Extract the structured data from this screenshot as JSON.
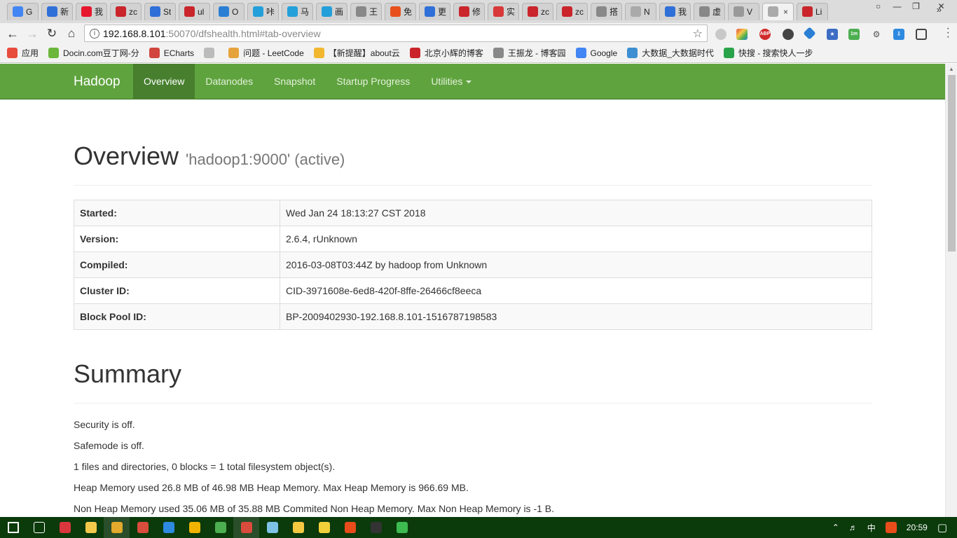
{
  "tabs": [
    {
      "title": "G",
      "icon": "google-icon",
      "color": "#4285f4"
    },
    {
      "title": "新",
      "icon": "baidu-icon",
      "color": "#2f6fd8"
    },
    {
      "title": "我",
      "icon": "weibo-icon",
      "color": "#e6162d"
    },
    {
      "title": "zc",
      "icon": "csdn-icon",
      "color": "#c9252b"
    },
    {
      "title": "St",
      "icon": "baidu-icon",
      "color": "#2f6fd8"
    },
    {
      "title": "ul",
      "icon": "csdn-icon",
      "color": "#c9252b"
    },
    {
      "title": "O",
      "icon": "diamond-icon",
      "color": "#2a7fd4"
    },
    {
      "title": "咔",
      "icon": "tv-icon",
      "color": "#23a0da"
    },
    {
      "title": "马",
      "icon": "tv-icon",
      "color": "#23a0da"
    },
    {
      "title": "画",
      "icon": "tv-icon",
      "color": "#23a0da"
    },
    {
      "title": "王",
      "icon": "cnblogs-icon",
      "color": "#888888"
    },
    {
      "title": "免",
      "icon": "q-icon",
      "color": "#e8511c"
    },
    {
      "title": "更",
      "icon": "baidu-icon",
      "color": "#2f6fd8"
    },
    {
      "title": "修",
      "icon": "csdn-icon",
      "color": "#c9252b"
    },
    {
      "title": "实",
      "icon": "red-icon",
      "color": "#d8383a"
    },
    {
      "title": "zc",
      "icon": "csdn-icon",
      "color": "#c9252b"
    },
    {
      "title": "zc",
      "icon": "csdn-icon",
      "color": "#c9252b"
    },
    {
      "title": "搭",
      "icon": "cnblogs-icon",
      "color": "#888888"
    },
    {
      "title": "N",
      "icon": "page-icon",
      "color": "#aaaaaa"
    },
    {
      "title": "我",
      "icon": "baidu-icon",
      "color": "#2f6fd8"
    },
    {
      "title": "虚",
      "icon": "cnblogs-icon",
      "color": "#888888"
    },
    {
      "title": "V",
      "icon": "loading-icon",
      "color": "#999999"
    },
    {
      "title": "",
      "icon": "page-icon",
      "color": "#aaaaaa",
      "active": true,
      "close": "×"
    },
    {
      "title": "Li",
      "icon": "csdn-icon",
      "color": "#c9252b"
    }
  ],
  "toolbar": {
    "url_host": "192.168.8.101",
    "url_path": ":50070/dfshealth.html#tab-overview"
  },
  "bookmarks": [
    {
      "label": "应用",
      "icon": "apps-icon",
      "color": "#e84c3d"
    },
    {
      "label": "Docin.com豆丁网-分",
      "icon": "docin-icon",
      "color": "#6bb63b"
    },
    {
      "label": "ECharts",
      "icon": "echarts-icon",
      "color": "#d2453f"
    },
    {
      "label": "",
      "icon": "page-icon",
      "color": "#bbbbbb"
    },
    {
      "label": "问题 - LeetCode",
      "icon": "leetcode-icon",
      "color": "#e6a33b"
    },
    {
      "label": "【新提醒】about云",
      "icon": "mail-icon",
      "color": "#f0b72f"
    },
    {
      "label": "北京小辉的博客",
      "icon": "csdn-icon",
      "color": "#c9252b"
    },
    {
      "label": "王振龙 - 博客园",
      "icon": "cnblogs-icon",
      "color": "#888888"
    },
    {
      "label": "Google",
      "icon": "google-icon",
      "color": "#4285f4"
    },
    {
      "label": "大数据_大数据时代",
      "icon": "bigdata-icon",
      "color": "#3d8fd1"
    },
    {
      "label": "快搜 - 搜索快人一步",
      "icon": "kuaisou-icon",
      "color": "#29a34a"
    }
  ],
  "navbar": {
    "brand": "Hadoop",
    "items": [
      "Overview",
      "Datanodes",
      "Snapshot",
      "Startup Progress",
      "Utilities"
    ],
    "active": "Overview"
  },
  "overview": {
    "title": "Overview",
    "subtitle": "'hadoop1:9000' (active)",
    "rows": [
      {
        "key": "Started:",
        "value": "Wed Jan 24 18:13:27 CST 2018"
      },
      {
        "key": "Version:",
        "value": "2.6.4, rUnknown"
      },
      {
        "key": "Compiled:",
        "value": "2016-03-08T03:44Z by hadoop from Unknown"
      },
      {
        "key": "Cluster ID:",
        "value": "CID-3971608e-6ed8-420f-8ffe-26466cf8eeca"
      },
      {
        "key": "Block Pool ID:",
        "value": "BP-2009402930-192.168.8.101-1516787198583"
      }
    ]
  },
  "summary": {
    "title": "Summary",
    "lines": [
      "Security is off.",
      "Safemode is off.",
      "1 files and directories, 0 blocks = 1 total filesystem object(s).",
      "Heap Memory used 26.8 MB of 46.98 MB Heap Memory. Max Heap Memory is 966.69 MB.",
      "Non Heap Memory used 35.06 MB of 35.88 MB Commited Non Heap Memory. Max Non Heap Memory is -1 B."
    ]
  },
  "taskbar": {
    "apps": [
      {
        "icon": "windows-start-icon",
        "color": "#ffffff"
      },
      {
        "icon": "task-view-icon",
        "color": "#ffffff"
      },
      {
        "icon": "app-9-icon",
        "color": "#d9363e"
      },
      {
        "icon": "file-explorer-icon",
        "color": "#f4c94b"
      },
      {
        "icon": "chrome-green-icon",
        "color": "#e2a92c",
        "pinned": true
      },
      {
        "icon": "wps-icon",
        "color": "#d84d3c"
      },
      {
        "icon": "w-icon",
        "color": "#2d8ae0"
      },
      {
        "icon": "sticky-icon",
        "color": "#f0b400"
      },
      {
        "icon": "chrome-icon",
        "color": "#4caf50"
      },
      {
        "icon": "bird-icon",
        "color": "#d94b3c",
        "pinned": true
      },
      {
        "icon": "notepad-icon",
        "color": "#7ec3e6"
      },
      {
        "icon": "qq-icon",
        "color": "#f5c842"
      },
      {
        "icon": "player-icon",
        "color": "#f2d03a"
      },
      {
        "icon": "sogou-icon",
        "color": "#e84c1a"
      },
      {
        "icon": "cmd-icon",
        "color": "#333333"
      },
      {
        "icon": "q-green-icon",
        "color": "#3dbb50"
      }
    ],
    "tray": {
      "ime": "中",
      "time": "20:59"
    }
  }
}
